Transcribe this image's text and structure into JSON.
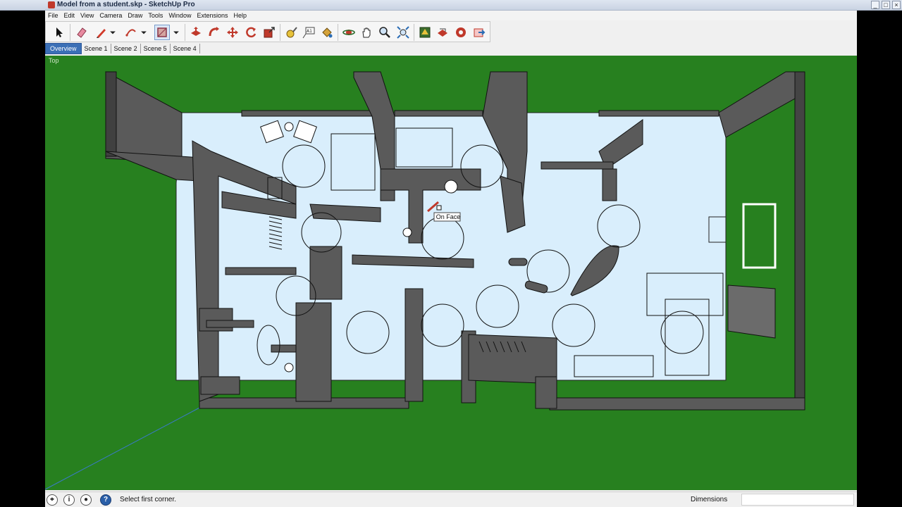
{
  "window": {
    "title": "Model from a student.skp - SketchUp Pro",
    "controls": [
      "_",
      "□",
      "×"
    ]
  },
  "menubar": {
    "items": [
      "File",
      "Edit",
      "View",
      "Camera",
      "Draw",
      "Tools",
      "Window",
      "Extensions",
      "Help"
    ]
  },
  "toolbar": {
    "tools": [
      "select-icon",
      "eraser-icon",
      "pencil-icon",
      "arc-icon",
      "rectangle-icon",
      "push-pull-icon",
      "follow-me-icon",
      "move-icon",
      "rotate-icon",
      "scale-icon",
      "tape-measure-icon",
      "text-icon",
      "paint-bucket-icon",
      "orbit-icon",
      "pan-icon",
      "zoom-icon",
      "zoom-extents-icon",
      "warehouse-icon",
      "share-model-icon",
      "extension-warehouse-icon",
      "send-to-layout-icon"
    ]
  },
  "scenes": {
    "tabs": [
      "Overview",
      "Scene 1",
      "Scene 2",
      "Scene 5",
      "Scene 4"
    ],
    "selected": "Overview"
  },
  "viewport": {
    "view_name": "Top",
    "tooltip": "On Face",
    "colors": {
      "ground": "#27801f",
      "floor": "#d9eefc",
      "walls": "#5a5a5a"
    }
  },
  "statusbar": {
    "message": "Select first corner.",
    "vcb_label": "Dimensions",
    "vcb_value": ""
  }
}
